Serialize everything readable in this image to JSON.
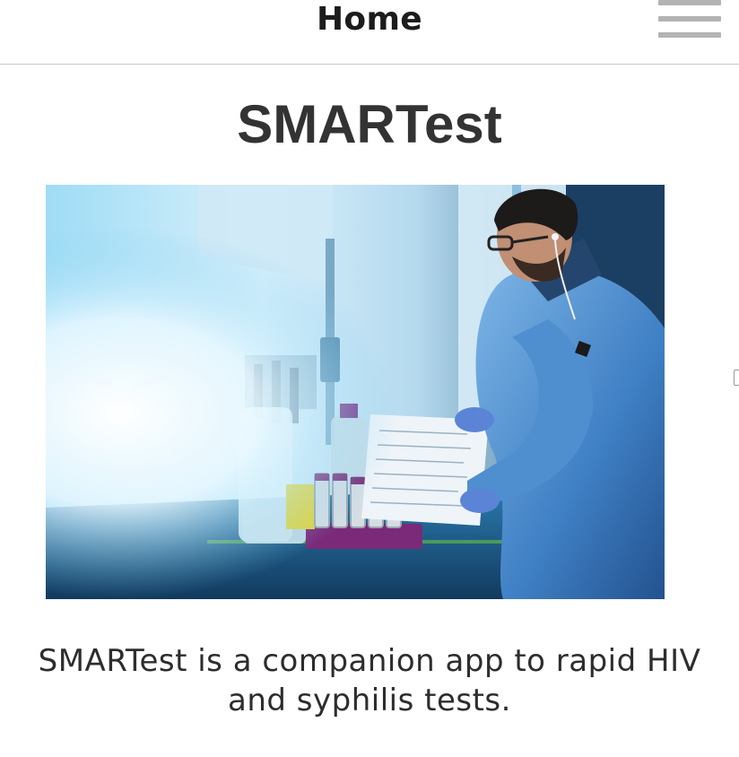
{
  "header": {
    "title": "Home",
    "menu_icon": "hamburger-menu-icon"
  },
  "main": {
    "app_name": "SMARTest",
    "hero_image": "laboratory-researcher-photo",
    "description": "SMARTest is a companion app to rapid HIV and syphilis tests."
  },
  "colors": {
    "header_border": "#c9c9c9",
    "menu_icon": "#b3b3b3",
    "text": "#2d2d2d"
  }
}
